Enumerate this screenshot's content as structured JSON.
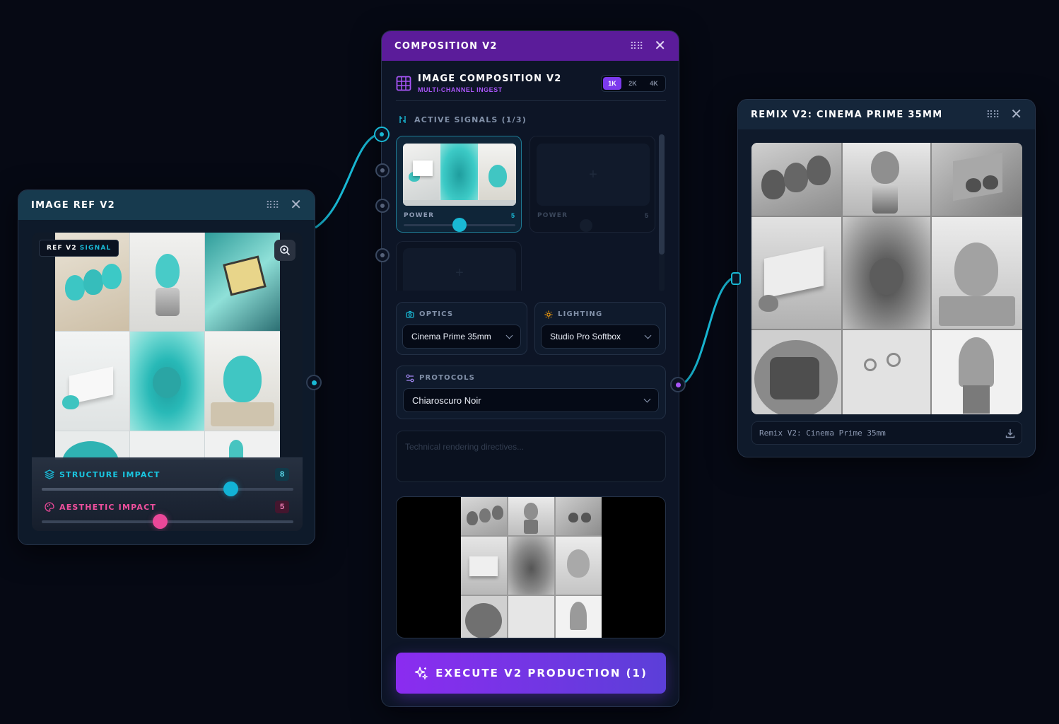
{
  "ref_node": {
    "title": "IMAGE REF V2",
    "badge_prefix": "REF V2",
    "badge_accent": "SIGNAL",
    "structure_label": "STRUCTURE IMPACT",
    "structure_value": "8",
    "structure_fraction": 0.75,
    "aesthetic_label": "AESTHETIC IMPACT",
    "aesthetic_value": "5",
    "aesthetic_fraction": 0.47
  },
  "comp_node": {
    "title": "COMPOSITION V2",
    "panel_title": "IMAGE COMPOSITION V2",
    "panel_subtitle": "MULTI-CHANNEL INGEST",
    "resolutions": [
      "1K",
      "2K",
      "4K"
    ],
    "active_resolution": "1K",
    "signals_label": "ACTIVE SIGNALS (1/3)",
    "slot1_power_label": "POWER",
    "slot1_power_value": "5",
    "slot1_power_fraction": 0.5,
    "slot2_power_label": "POWER",
    "slot2_power_value": "5",
    "optics_label": "OPTICS",
    "optics_value": "Cinema Prime 35mm",
    "lighting_label": "LIGHTING",
    "lighting_value": "Studio Pro Softbox",
    "protocols_label": "PROTOCOLS",
    "protocols_value": "Chiaroscuro Noir",
    "directives_placeholder": "Technical rendering directives...",
    "execute_label": "EXECUTE V2 PRODUCTION (1)"
  },
  "remix_node": {
    "title": "REMIX V2: CINEMA PRIME 35MM",
    "caption": "Remix V2: Cinema Prime 35mm"
  },
  "colors": {
    "teal": "#19b8d4",
    "purple": "#7c3aed",
    "pink": "#ec4899",
    "orange": "#f59e0b"
  }
}
